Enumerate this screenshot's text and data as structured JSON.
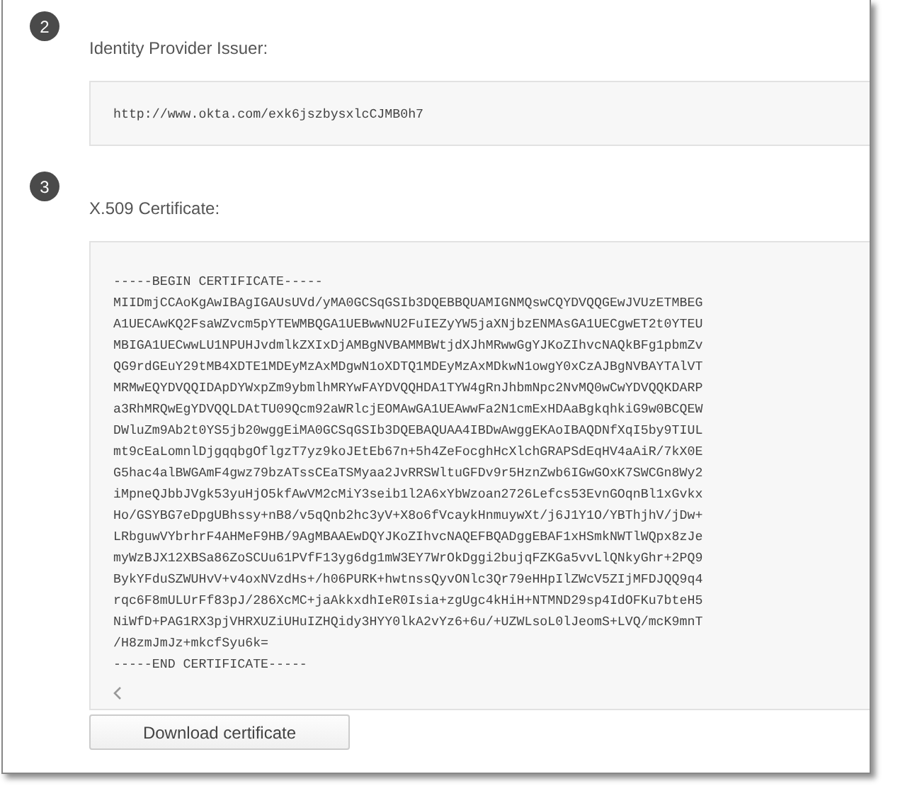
{
  "steps": [
    {
      "number": "2",
      "label": "Identity Provider Issuer:",
      "kind": "value",
      "lines": [
        "http://www.okta.com/exk6jszbysxlcCJMB0h7"
      ]
    },
    {
      "number": "3",
      "label": "X.509 Certificate:",
      "kind": "certificate",
      "lines": [
        "-----BEGIN CERTIFICATE-----",
        "MIIDmjCCAoKgAwIBAgIGAUsUVd/yMA0GCSqGSIb3DQEBBQUAMIGNMQswCQYDVQQGEwJVUzETMBEG",
        "A1UECAwKQ2FsaWZvcm5pYTEWMBQGA1UEBwwNU2FuIEZyYW5jaXNjbzENMAsGA1UECgwET2t0YTEU",
        "MBIGA1UECwwLU1NPUHJvdmlkZXIxDjAMBgNVBAMMBWtjdXJhMRwwGgYJKoZIhvcNAQkBFg1pbmZv",
        "QG9rdGEuY29tMB4XDTE1MDEyMzAxMDgwN1oXDTQ1MDEyMzAxMDkwN1owgY0xCzAJBgNVBAYTAlVT",
        "MRMwEQYDVQQIDApDYWxpZm9ybmlhMRYwFAYDVQQHDA1TYW4gRnJhbmNpc2NvMQ0wCwYDVQQKDARP",
        "a3RhMRQwEgYDVQQLDAtTU09Qcm92aWRlcjEOMAwGA1UEAwwFa2N1cmExHDAaBgkqhkiG9w0BCQEW",
        "DWluZm9Ab2t0YS5jb20wggEiMA0GCSqGSIb3DQEBAQUAA4IBDwAwggEKAoIBAQDNfXqI5by9TIUL",
        "mt9cEaLomnlDjgqqbgOflgzT7yz9koJEtEb67n+5h4ZeFocghHcXlchGRAPSdEqHV4aAiR/7kX0E",
        "G5hac4alBWGAmF4gwz79bzATssCEaTSMyaa2JvRRSWltuGFDv9r5HznZwb6IGwGOxK7SWCGn8Wy2",
        "iMpneQJbbJVgk53yuHjO5kfAwVM2cMiY3seib1l2A6xYbWzoan2726Lefcs53EvnGOqnBl1xGvkx",
        "Ho/GSYBG7eDpgUBhssy+nB8/v5qQnb2hc3yV+X8o6fVcaykHnmuywXt/j6J1Y1O/YBThjhV/jDw+",
        "LRbguwVYbrhrF4AHMeF9HB/9AgMBAAEwDQYJKoZIhvcNAQEFBQADggEBAF1xHSmkNWTlWQpx8zJe",
        "myWzBJX12XBSa86ZoSCUu61PVfF13yg6dg1mW3EY7WrOkDggi2bujqFZKGa5vvLlQNkyGhr+2PQ9",
        "BykYFduSZWUHvV+v4oxNVzdHs+/h06PURK+hwtnssQyvONlc3Qr79eHHpIlZWcV5ZIjMFDJQQ9q4",
        "rqc6F8mULUrFf83pJ/286XcMC+jaAkkxdhIeR0Isia+zgUgc4kHiH+NTMND29sp4IdOFKu7bteH5",
        "NiWfD+PAG1RX3pjVHRXUZiUHuIZHQidy3HYY0lkA2vYz6+6u/+UZWLsoL0lJeomS+LVQ/mcK9mnT",
        "/H8zmJmJz+mkcfSyu6k=",
        "-----END CERTIFICATE-----"
      ],
      "button": "Download certificate"
    }
  ]
}
